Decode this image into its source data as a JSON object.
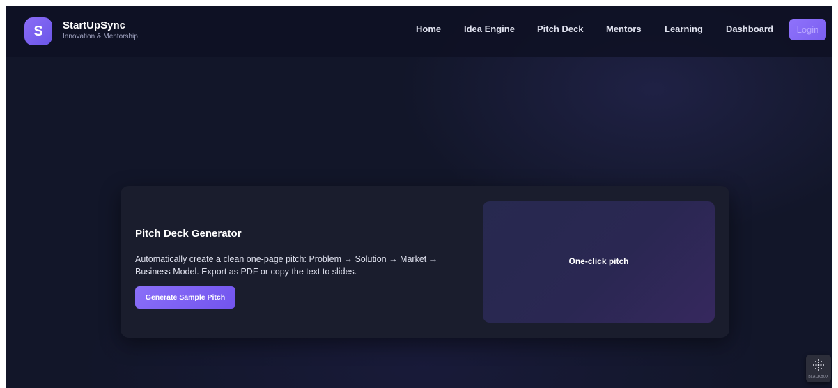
{
  "brand": {
    "logo_letter": "S",
    "name": "StartUpSync",
    "tagline": "Innovation & Mentorship"
  },
  "nav": {
    "items": [
      "Home",
      "Idea Engine",
      "Pitch Deck",
      "Mentors",
      "Learning",
      "Dashboard"
    ],
    "login_label": "Login"
  },
  "card": {
    "title": "Pitch Deck Generator",
    "description": "Automatically create a clean one-page pitch: Problem → Solution → Market → Business Model. Export as PDF or copy the text to slides.",
    "button_label": "Generate Sample Pitch",
    "preview_label": "One-click pitch"
  },
  "widget": {
    "label": "BLACKBOX",
    "icon": "dot-grid-icon"
  },
  "colors": {
    "background": "#121629",
    "card": "#1a1d2d",
    "accent": "#7c5cf3"
  }
}
